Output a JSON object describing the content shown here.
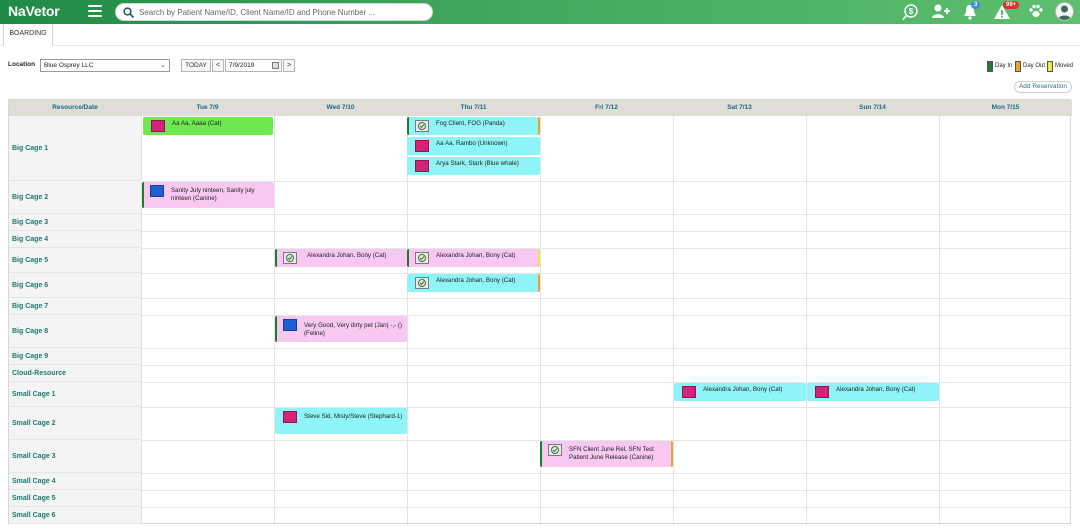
{
  "app": {
    "name": "NaVetor"
  },
  "search": {
    "placeholder": "Search by Patient Name/ID, Client Name/ID and Phone Number ..."
  },
  "topbar_icons": [
    {
      "name": "payment-icon"
    },
    {
      "name": "add-user-icon"
    },
    {
      "name": "notifications-icon",
      "badge": "3"
    },
    {
      "name": "alert-icon",
      "badge": "99+"
    },
    {
      "name": "paw-icon"
    },
    {
      "name": "avatar"
    }
  ],
  "tabs": [
    {
      "label": "BOARDING"
    }
  ],
  "controls": {
    "location_label": "Location",
    "location_value": "Blue Osprey LLC",
    "today_label": "TODAY",
    "prev_label": "<",
    "next_label": ">",
    "date_value": "7/9/2019",
    "add_reservation_label": "Add Reservation"
  },
  "legend": [
    {
      "label": "Day In",
      "color": "#1e7a2c"
    },
    {
      "label": "Day Out",
      "color": "#f2a128"
    },
    {
      "label": "Moved",
      "color": "#ece640"
    }
  ],
  "grid": {
    "resource_header": "Resource/Date",
    "days": [
      "Tue 7/9",
      "Wed 7/10",
      "Thu 7/11",
      "Fri 7/12",
      "Sat 7/13",
      "Sun 7/14",
      "Mon 7/15"
    ],
    "resources": [
      "Big Cage 1",
      "Big Cage 2",
      "Big Cage 3",
      "Big Cage 4",
      "Big Cage 5",
      "Big Cage 6",
      "Big Cage 7",
      "Big Cage 8",
      "Big Cage 9",
      "Cloud-Resource",
      "Small Cage 1",
      "Small Cage 2",
      "Small Cage 3",
      "Small Cage 4",
      "Small Cage 5",
      "Small Cage 6"
    ]
  },
  "reservations": [
    {
      "label": "Aa Aa, Aaaa (Cat)"
    },
    {
      "label": "Fog Client, FOG (Panda)"
    },
    {
      "label": "Aa Aa, Rambo (Unknown)"
    },
    {
      "label": "Arya Stark, Stark (Blue whale)"
    },
    {
      "label": "Sanity July ninteen, Sanity july ninteen (Canine)"
    },
    {
      "label": "Alexandra Johan, Bony (Cat)"
    },
    {
      "label": "Alexandra Johan, Bony (Cat)"
    },
    {
      "label": "Alexandra Johan, Bony (Cat)"
    },
    {
      "label": "Very Good, Very dirty pet (Jan) -,- () (Feline)"
    },
    {
      "label": "Alexandra Johan, Bony (Cat)"
    },
    {
      "label": "Alexandra Johan, Bony (Cat)"
    },
    {
      "label": "Steve Sid, Misty/Steve (Stephard-1)"
    },
    {
      "label": "SFN Client June Rel, SFN Test Patient June Release (Canine)"
    }
  ]
}
